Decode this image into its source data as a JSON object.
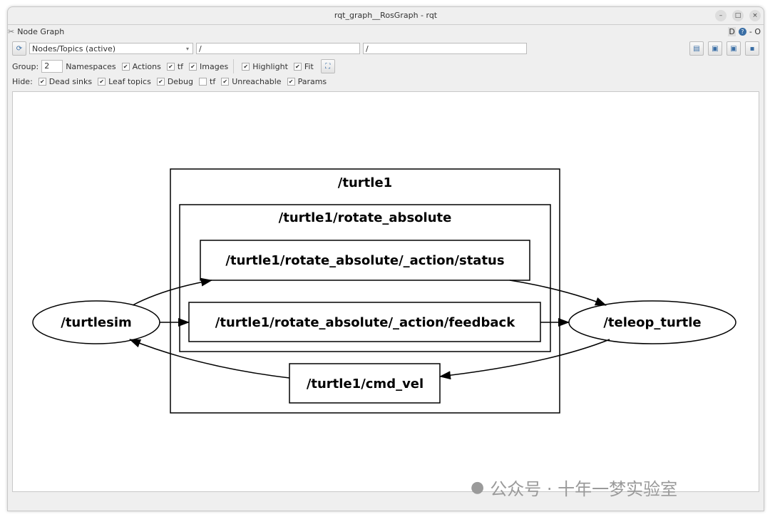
{
  "window": {
    "title": "rqt_graph__RosGraph - rqt",
    "minimize": "–",
    "maximize": "□",
    "close": "×"
  },
  "plugin": {
    "title": "Node Graph",
    "right_labels": "D",
    "right_extra": "- O"
  },
  "toolbar": {
    "mode_select": "Nodes/Topics (active)",
    "filter1": "/",
    "filter2": "/",
    "group_label": "Group:",
    "group_value": "2",
    "namespaces": "Namespaces",
    "options": [
      {
        "label": "Actions",
        "checked": true
      },
      {
        "label": "tf",
        "checked": true
      },
      {
        "label": "Images",
        "checked": true
      },
      {
        "label": "Highlight",
        "checked": true
      },
      {
        "label": "Fit",
        "checked": true
      }
    ],
    "hide_label": "Hide:",
    "hide": [
      {
        "label": "Dead sinks",
        "checked": true
      },
      {
        "label": "Leaf topics",
        "checked": true
      },
      {
        "label": "Debug",
        "checked": true
      },
      {
        "label": "tf",
        "checked": false
      },
      {
        "label": "Unreachable",
        "checked": true
      },
      {
        "label": "Params",
        "checked": true
      }
    ]
  },
  "graph": {
    "clusters": [
      "/turtle1",
      "/turtle1/rotate_absolute"
    ],
    "topics": [
      "/turtle1/rotate_absolute/_action/status",
      "/turtle1/rotate_absolute/_action/feedback",
      "/turtle1/cmd_vel"
    ],
    "nodes": [
      "/turtlesim",
      "/teleop_turtle"
    ],
    "edges": [
      {
        "from": "/turtlesim",
        "to": "/turtle1/rotate_absolute/_action/status"
      },
      {
        "from": "/turtlesim",
        "to": "/turtle1/rotate_absolute/_action/feedback"
      },
      {
        "from": "/turtle1/rotate_absolute/_action/status",
        "to": "/teleop_turtle"
      },
      {
        "from": "/turtle1/rotate_absolute/_action/feedback",
        "to": "/teleop_turtle"
      },
      {
        "from": "/teleop_turtle",
        "to": "/turtle1/cmd_vel"
      },
      {
        "from": "/turtle1/cmd_vel",
        "to": "/turtlesim"
      }
    ]
  },
  "watermark": "公众号 · 十年一梦实验室"
}
